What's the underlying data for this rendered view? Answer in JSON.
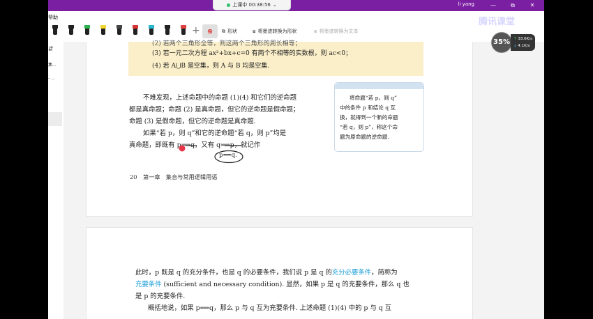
{
  "recording": {
    "label": "上课中 00:38:56",
    "chevron": "⌄"
  },
  "title_bar": {
    "user": "li yang",
    "minimize": "—",
    "maximize": "⧉",
    "close": "✕"
  },
  "menu": {
    "help": "帮助"
  },
  "toolbar": {
    "pen_colors": [
      "#222222",
      "#222222",
      "#2bb24c",
      "#f1d531",
      "#444444",
      "#d93535",
      "#2ab7d0",
      "#222222",
      "#e04040"
    ],
    "shape_label": "形状",
    "convert_shape_label": "将墨迹转换为形状",
    "convert_text_label": "将墨迹转换为文本"
  },
  "sidebar": {
    "item1": "集...",
    "item2": "- ..."
  },
  "page1": {
    "yellow_lines": [
      "(2) 若两个三角形全等，则这两个三角形的周长相等；",
      "(3) 若一元二次方程 ax²+bx+c=0 有两个不相等的实数根，则 ac<0；",
      "(4) 若 A⋃B 是空集，则 A 与 B 均是空集."
    ],
    "body_lines": [
      "不难发现，上述命题中的命题 (1)(4) 和它们的逆命题",
      "都是真命题；命题 (2) 是真命题，但它的逆命题是假命题；",
      "命题 (3) 是假命题，但它的逆命题是真命题.",
      "如果“若 p，则 q”和它的逆命题“若 q，则 p”均是",
      "真命题，即既有 p⟹q，又有 q⟹p，就记作"
    ],
    "note_lines": [
      "将命题“若 p，则 q”",
      "中的条件 p 和结论 q 互",
      "换，就得到一个新的命题",
      "“若 q，则 p”，称这个命",
      "题为原命题的逆命题."
    ],
    "formula": "p⟺q.",
    "page_number": "20",
    "chapter": "第一章　集合与常用逻辑用语"
  },
  "page2": {
    "line1_a": "此时，p 既是 q 的充分条件，也是 q 的必要条件，我们说 p 是 q 的",
    "line1_hl": "充分必要条件",
    "line1_b": "，简称为",
    "line2_hl": "充要条件",
    "line2_b": " (sufficient and necessary condition). 显然，如果 p 是 q 的充要条件，那么 q 也",
    "line3": "是 p 的充要条件.",
    "line4": "概括地说，如果 p⟺q，那么 p 与 q 互为充要条件. 上述命题 (1)(4) 中的 p 与 q 互"
  },
  "overlay": {
    "watermark": "腾讯课堂",
    "cpu": "35%",
    "upload": "33.6K/s",
    "download": "4.1K/s"
  }
}
